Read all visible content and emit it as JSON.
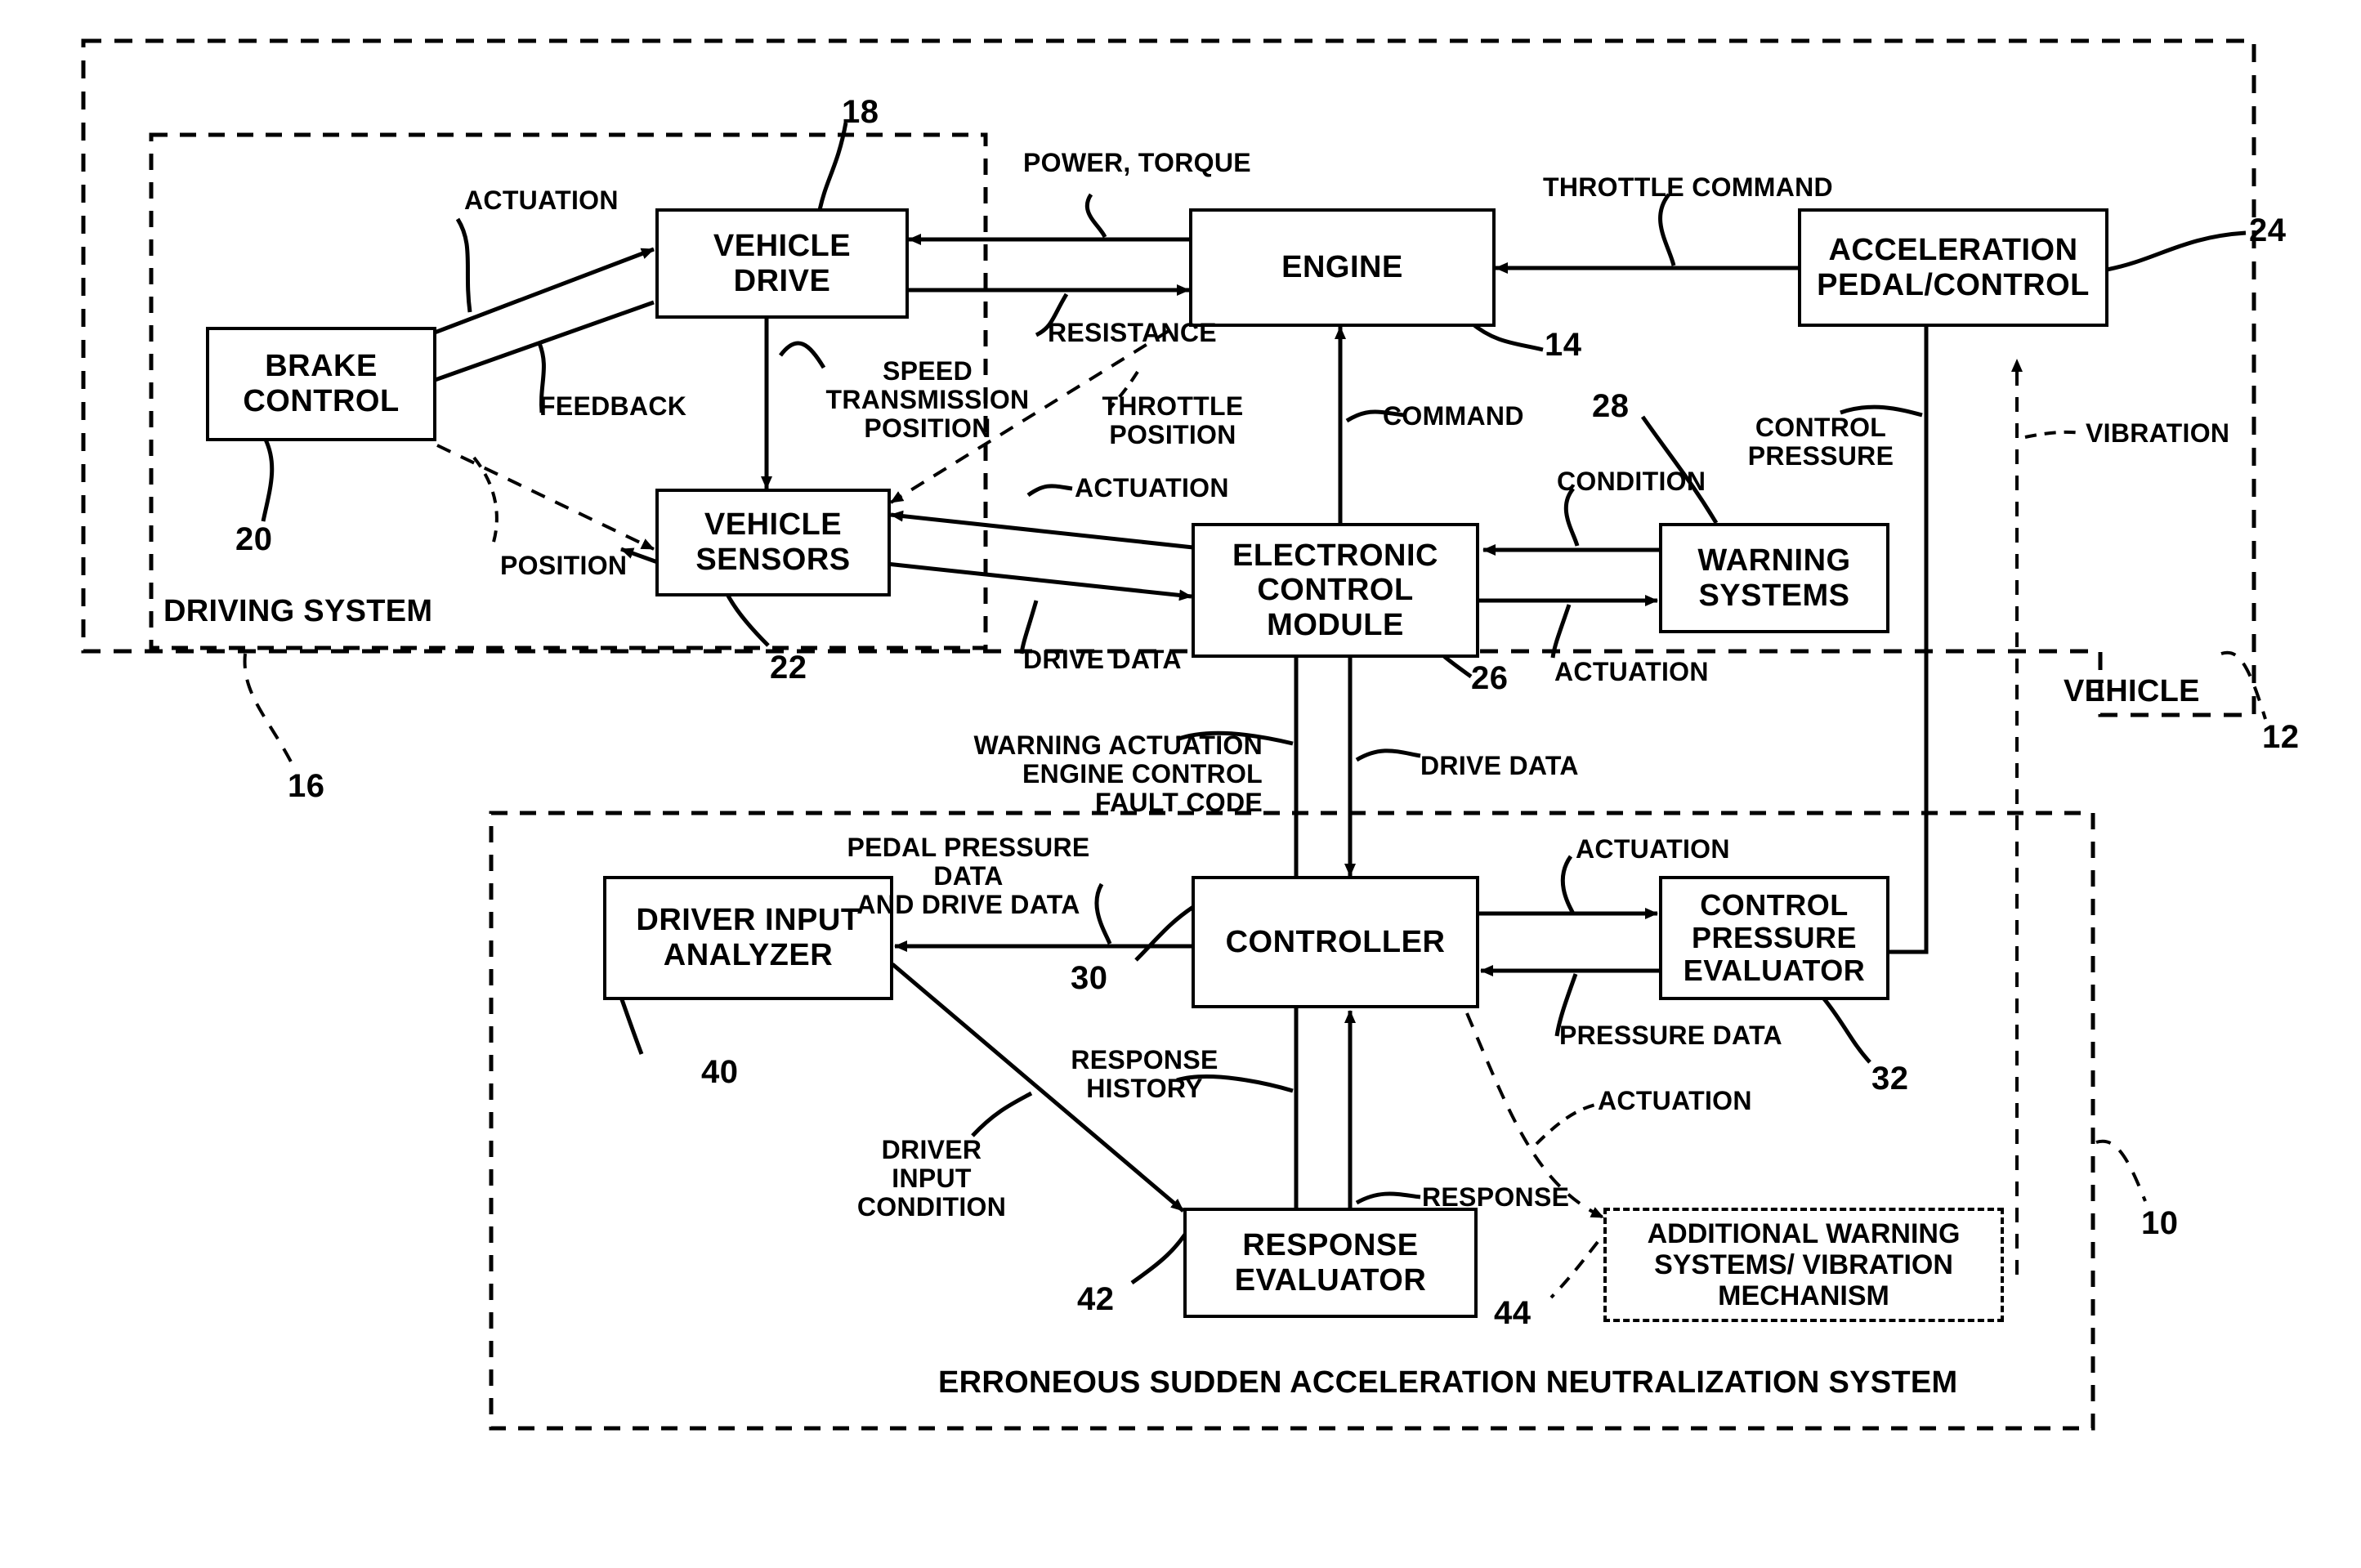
{
  "figure": {
    "type": "patent-block-diagram",
    "title": "Erroneous sudden acceleration neutralization system block diagram"
  },
  "enclosures": [
    {
      "id": "vehicle",
      "label": "VEHICLE",
      "ref": "12",
      "style": "dashed"
    },
    {
      "id": "driving-system",
      "label": "DRIVING SYSTEM",
      "ref": "16",
      "style": "dashed"
    },
    {
      "id": "esans",
      "label": "ERRONEOUS SUDDEN ACCELERATION NEUTRALIZATION SYSTEM",
      "ref": "10",
      "style": "dashed"
    }
  ],
  "blocks": [
    {
      "id": "vehicle-drive",
      "label": "VEHICLE\nDRIVE",
      "ref": "18",
      "style": "solid"
    },
    {
      "id": "brake-control",
      "label": "BRAKE\nCONTROL",
      "ref": "20",
      "style": "solid"
    },
    {
      "id": "vehicle-sensors",
      "label": "VEHICLE\nSENSORS",
      "ref": "22",
      "style": "solid"
    },
    {
      "id": "engine",
      "label": "ENGINE",
      "ref": "14",
      "style": "solid"
    },
    {
      "id": "acceleration-pedal-control",
      "label": "ACCELERATION\nPEDAL/CONTROL",
      "ref": "24",
      "style": "solid"
    },
    {
      "id": "electronic-control-module",
      "label": "ELECTRONIC\nCONTROL\nMODULE",
      "ref": "26",
      "style": "solid"
    },
    {
      "id": "warning-systems",
      "label": "WARNING\nSYSTEMS",
      "ref": "28",
      "style": "solid"
    },
    {
      "id": "controller",
      "label": "CONTROLLER",
      "ref": "30",
      "style": "solid"
    },
    {
      "id": "control-pressure-evaluator",
      "label": "CONTROL\nPRESSURE\nEVALUATOR",
      "ref": "32",
      "style": "solid"
    },
    {
      "id": "driver-input-analyzer",
      "label": "DRIVER INPUT\nANALYZER",
      "ref": "40",
      "style": "solid"
    },
    {
      "id": "response-evaluator",
      "label": "RESPONSE\nEVALUATOR",
      "ref": "42",
      "style": "solid"
    },
    {
      "id": "additional-warning-systems",
      "label": "ADDITIONAL\nWARNING SYSTEMS/\nVIBRATION MECHANISM",
      "ref": "44",
      "style": "dashed"
    }
  ],
  "edge_labels": [
    {
      "id": "actuation-brake-drive",
      "text": "ACTUATION"
    },
    {
      "id": "feedback-drive-brake",
      "text": "FEEDBACK"
    },
    {
      "id": "speed-transmission-position",
      "text": "SPEED\nTRANSMISSION\nPOSITION"
    },
    {
      "id": "power-torque",
      "text": "POWER, TORQUE"
    },
    {
      "id": "resistance",
      "text": "RESISTANCE"
    },
    {
      "id": "throttle-command",
      "text": "THROTTLE COMMAND"
    },
    {
      "id": "throttle-position",
      "text": "THROTTLE\nPOSITION"
    },
    {
      "id": "command",
      "text": "COMMAND"
    },
    {
      "id": "control-pressure",
      "text": "CONTROL\nPRESSURE"
    },
    {
      "id": "vibration",
      "text": "VIBRATION"
    },
    {
      "id": "condition",
      "text": "CONDITION"
    },
    {
      "id": "position",
      "text": "POSITION"
    },
    {
      "id": "actuation-ecm-sensors",
      "text": "ACTUATION"
    },
    {
      "id": "drive-data-sensors-ecm",
      "text": "DRIVE DATA"
    },
    {
      "id": "actuation-ecm-warning",
      "text": "ACTUATION"
    },
    {
      "id": "warning-actuation-engine-control-fault-code",
      "text": "WARNING ACTUATION\nENGINE CONTROL\nFAULT CODE"
    },
    {
      "id": "drive-data-ecm-controller",
      "text": "DRIVE DATA"
    },
    {
      "id": "pedal-pressure-and-drive-data",
      "text": "PEDAL PRESSURE DATA\nAND DRIVE DATA"
    },
    {
      "id": "actuation-controller-cpe",
      "text": "ACTUATION"
    },
    {
      "id": "pressure-data",
      "text": "PRESSURE DATA"
    },
    {
      "id": "response-history",
      "text": "RESPONSE\nHISTORY"
    },
    {
      "id": "driver-input-condition",
      "text": "DRIVER\nINPUT\nCONDITION"
    },
    {
      "id": "response",
      "text": "RESPONSE"
    },
    {
      "id": "actuation-controller-aws",
      "text": "ACTUATION"
    }
  ]
}
